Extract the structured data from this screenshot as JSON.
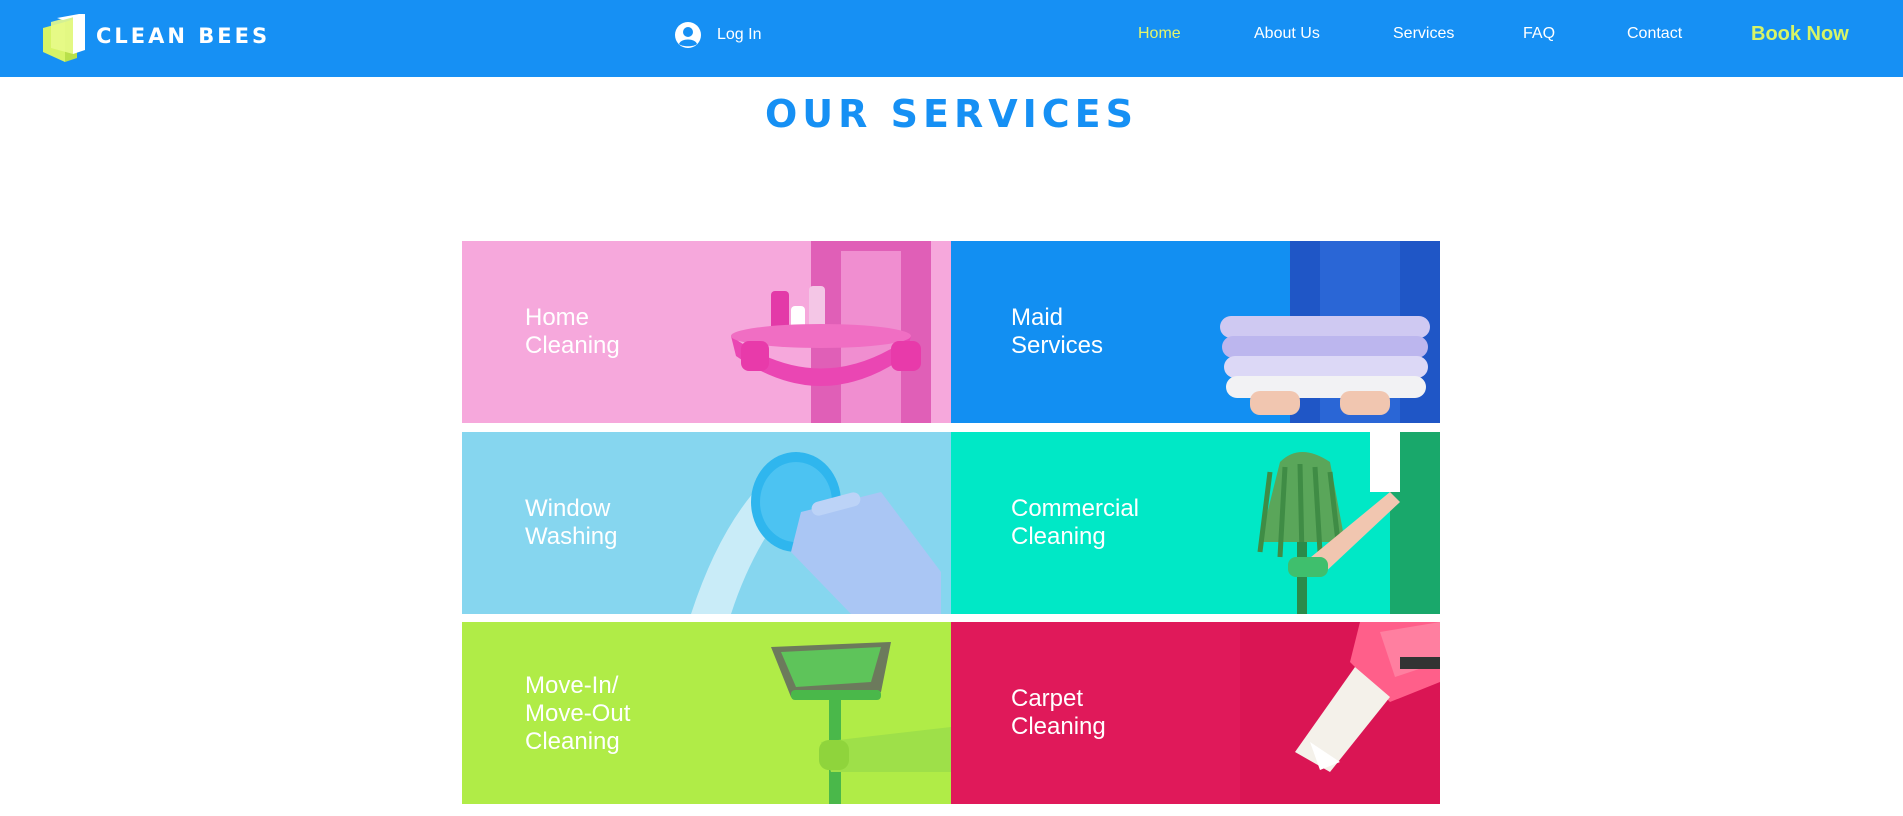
{
  "header": {
    "brand": "CLEAN BEES",
    "login_label": "Log In",
    "nav": [
      "Home",
      "About Us",
      "Services",
      "FAQ",
      "Contact"
    ],
    "active_nav": "Home",
    "cta": "Book Now"
  },
  "main": {
    "heading": "OUR SERVICES",
    "services": [
      {
        "label": "Home\nCleaning",
        "color": "#f6a8dc"
      },
      {
        "label": "Maid\nServices",
        "color": "#128ff2"
      },
      {
        "label": "Window\nWashing",
        "color": "#86d6ef"
      },
      {
        "label": "Commercial\nCleaning",
        "color": "#00e8c6"
      },
      {
        "label": "Move-In/\nMove-Out\nCleaning",
        "color": "#b0ec47"
      },
      {
        "label": "Carpet\nCleaning",
        "color": "#e0195a"
      }
    ]
  },
  "colors": {
    "header_bg": "#1690f4",
    "accent": "#d7f466",
    "heading": "#1690f4"
  }
}
